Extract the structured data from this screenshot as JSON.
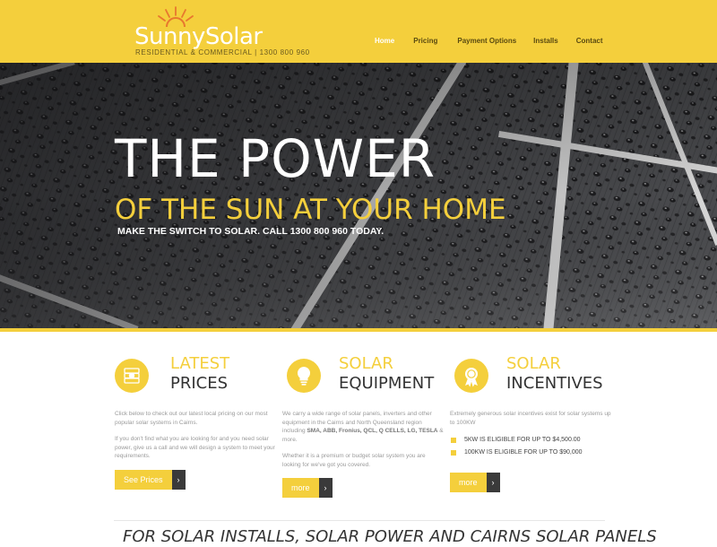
{
  "brand": {
    "name": "SunnySolar",
    "tagline": "RESIDENTIAL & COMMERCIAL | 1300 800 960",
    "colors": {
      "accent": "#f4cf3c",
      "dark": "#3a3a3a"
    }
  },
  "nav": {
    "items": [
      {
        "label": "Home",
        "active": true
      },
      {
        "label": "Pricing"
      },
      {
        "label": "Payment Options"
      },
      {
        "label": "Installs"
      },
      {
        "label": "Contact"
      }
    ]
  },
  "hero": {
    "title": "THE POWER",
    "subtitle": "OF THE SUN AT YOUR HOME",
    "cta": "MAKE THE SWITCH TO SOLAR. CALL 1300 800 960 TODAY."
  },
  "features": [
    {
      "icon": "money-stack-icon",
      "heading_line1": "LATEST",
      "heading_line2": "PRICES",
      "paragraphs": [
        "Click below to check out our latest local pricing on our most popular solar systems in Cairns.",
        "If you don't find what you are looking for and you need solar power, give us a call and we will design a system to meet your requirements."
      ],
      "button": "See Prices"
    },
    {
      "icon": "lightbulb-icon",
      "heading_line1": "SOLAR",
      "heading_line2": "EQUIPMENT",
      "paragraph1_before": "We carry a wide range of solar panels, inverters and other equipment in the Cairns and North Queensland region including ",
      "paragraph1_brands": "SMA, ABB, Fronius, QCL, Q CELLS, LG, TESLA",
      "paragraph1_after": " & more.",
      "paragraph2": "Whether it is a premium or budget solar system you are looking for we've got you covered.",
      "button": "more"
    },
    {
      "icon": "award-ribbon-icon",
      "heading_line1": "SOLAR",
      "heading_line2": "INCENTIVES",
      "paragraph": "Extremely generous solar incentives exist for solar systems up to 100KW",
      "bullets": [
        "5KW IS ELIGIBLE FOR UP TO $4,500.00",
        "100KW IS ELIGIBLE FOR UP TO $90,000"
      ],
      "button": "more"
    }
  ],
  "footer_heading": "FOR SOLAR INSTALLS, SOLAR POWER AND CAIRNS SOLAR PANELS"
}
